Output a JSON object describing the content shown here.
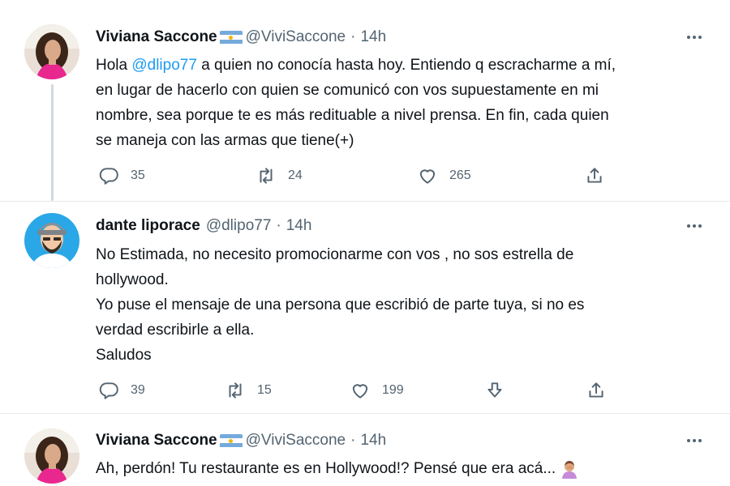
{
  "tweets": [
    {
      "name": "Viviana Saccone",
      "handle": "@ViviSaccone",
      "dot": "·",
      "time": "14h",
      "text_lines": [
        [
          "Hola ",
          "@dlipo77",
          " a quien no conocía hasta hoy. Entiendo q escracharme a mí,"
        ],
        "en lugar de hacerlo con quien se comunicó con vos supuestamente en mi",
        "nombre, sea porque te es más redituable a nivel prensa. En fin, cada quien",
        "se maneja con las armas que tiene(+)"
      ],
      "replies": "35",
      "retweets": "24",
      "likes": "265"
    },
    {
      "name": "dante liporace",
      "handle": "@dlipo77",
      "dot": "·",
      "time": "14h",
      "text_lines": [
        "No Estimada, no necesito promocionarme con vos , no sos estrella de",
        "hollywood.",
        "Yo puse el mensaje de una persona que escribió de parte tuya,  si no es",
        "verdad escribirle a ella.",
        "Saludos"
      ],
      "replies": "39",
      "retweets": "15",
      "likes": "199"
    },
    {
      "name": "Viviana Saccone",
      "handle": "@ViviSaccone",
      "dot": "·",
      "time": "14h",
      "text_lines": [
        "Ah, perdón! Tu restaurante es en Hollywood!? Pensé que era acá..."
      ]
    }
  ],
  "icons": {
    "reply": "reply-icon",
    "retweet": "retweet-icon",
    "like": "heart-icon",
    "share": "share-icon",
    "downvote": "downvote-icon",
    "more": "more-icon",
    "flag": "argentina-flag-icon",
    "emoji": "person-facepalming-emoji"
  },
  "colors": {
    "text": "#0f1419",
    "secondary": "#536471",
    "mention": "#1d9bf0",
    "thread_line": "#cfd9de"
  }
}
